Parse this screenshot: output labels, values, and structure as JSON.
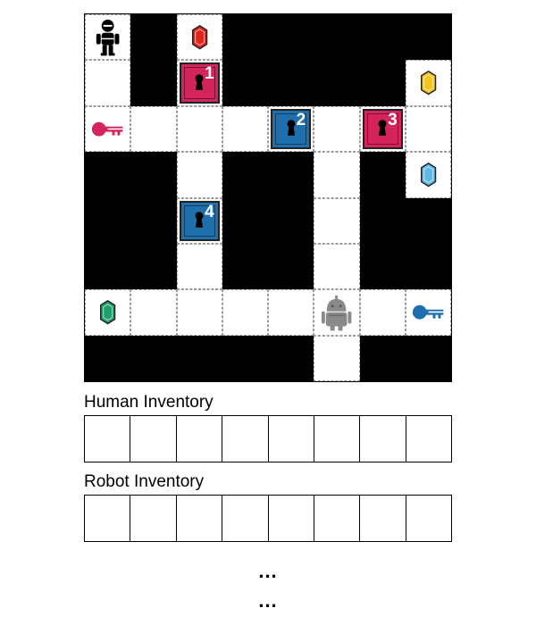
{
  "board": {
    "rows": 8,
    "cols": 8,
    "grid": [
      "OWOWWWWW",
      "OWOWWWWO",
      "OOOOOOOO",
      "WWOWWOWO",
      "WWOWWOWW",
      "WWOWWOWW",
      "OOOOOOOO",
      "WWWWWOWW"
    ],
    "colors": {
      "wall": "#000000",
      "floor": "#ffffff",
      "red": "#d4245c",
      "blue": "#1f6fad",
      "gem_red": "#e2231a",
      "gem_yellow": "#f5c518",
      "gem_cyan": "#5fb8e8",
      "gem_green": "#1f9e6b",
      "robot": "#8a8a8a"
    },
    "items": [
      {
        "type": "human",
        "row": 0,
        "col": 0,
        "icon": "human-icon"
      },
      {
        "type": "gem",
        "row": 0,
        "col": 2,
        "color": "gem_red",
        "icon": "gem-red-icon"
      },
      {
        "type": "door",
        "row": 1,
        "col": 2,
        "color": "red",
        "number": "1",
        "icon": "keyhole-icon"
      },
      {
        "type": "gem",
        "row": 1,
        "col": 7,
        "color": "gem_yellow",
        "icon": "gem-yellow-icon"
      },
      {
        "type": "key",
        "row": 2,
        "col": 0,
        "color": "red",
        "icon": "key-red-icon"
      },
      {
        "type": "door",
        "row": 2,
        "col": 4,
        "color": "blue",
        "number": "2",
        "icon": "keyhole-icon"
      },
      {
        "type": "door",
        "row": 2,
        "col": 6,
        "color": "red",
        "number": "3",
        "icon": "keyhole-icon"
      },
      {
        "type": "gem",
        "row": 3,
        "col": 7,
        "color": "gem_cyan",
        "icon": "gem-cyan-icon"
      },
      {
        "type": "door",
        "row": 4,
        "col": 2,
        "color": "blue",
        "number": "4",
        "icon": "keyhole-icon"
      },
      {
        "type": "gem",
        "row": 6,
        "col": 0,
        "color": "gem_green",
        "icon": "gem-green-icon"
      },
      {
        "type": "robot",
        "row": 6,
        "col": 5,
        "icon": "robot-icon"
      },
      {
        "type": "key",
        "row": 6,
        "col": 7,
        "color": "blue",
        "icon": "key-blue-icon"
      }
    ]
  },
  "human_inventory": {
    "label": "Human Inventory",
    "slots": 8
  },
  "robot_inventory": {
    "label": "Robot Inventory",
    "slots": 8
  },
  "ellipsis": [
    "...",
    "..."
  ]
}
